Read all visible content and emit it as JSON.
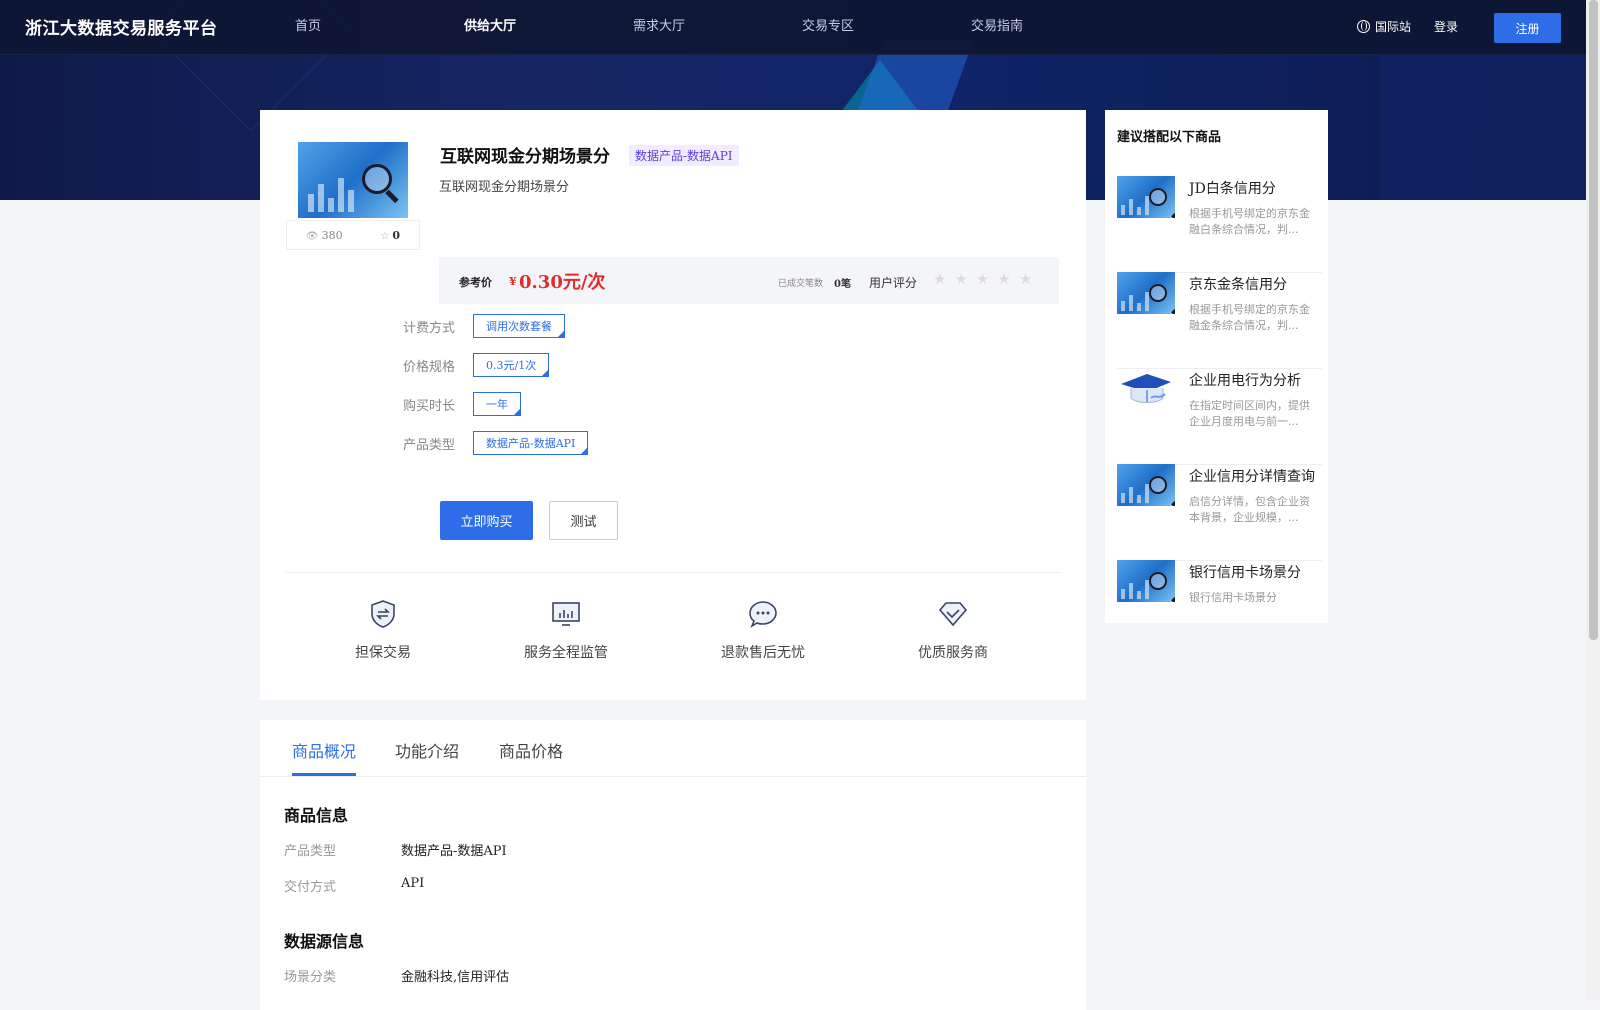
{
  "header": {
    "logo": "浙江大数据交易服务平台",
    "nav": [
      "首页",
      "供给大厅",
      "需求大厅",
      "交易专区",
      "交易指南"
    ],
    "active_nav": "供给大厅",
    "intl": "国际站",
    "login": "登录",
    "register": "注册"
  },
  "product": {
    "title": "互联网现金分期场景分",
    "tag": "数据产品-数据API",
    "desc": "互联网现金分期场景分",
    "views": "380",
    "favorites": "0",
    "price_label": "参考价",
    "price_symbol": "¥",
    "price_value": "0.30元/次",
    "deals_label": "已成交笔数",
    "deals_value": "0笔",
    "rating_label": "用户评分",
    "rating_stars": 0,
    "options": [
      {
        "label": "计费方式",
        "value": "调用次数套餐"
      },
      {
        "label": "价格规格",
        "value": "0.3元/1次"
      },
      {
        "label": "购买时长",
        "value": "一年"
      },
      {
        "label": "产品类型",
        "value": "数据产品-数据API"
      }
    ],
    "buy_label": "立即购买",
    "test_label": "测试"
  },
  "features": [
    {
      "icon": "shield-exchange-icon",
      "label": "担保交易"
    },
    {
      "icon": "monitor-chart-icon",
      "label": "服务全程监管"
    },
    {
      "icon": "chat-bubble-icon",
      "label": "退款售后无忧"
    },
    {
      "icon": "diamond-check-icon",
      "label": "优质服务商"
    }
  ],
  "tabs": [
    "商品概况",
    "功能介绍",
    "商品价格"
  ],
  "active_tab": "商品概况",
  "details": {
    "section1_title": "商品信息",
    "section1": [
      {
        "k": "产品类型",
        "v": "数据产品-数据API"
      },
      {
        "k": "交付方式",
        "v": "API"
      }
    ],
    "section2_title": "数据源信息",
    "section2": [
      {
        "k": "场景分类",
        "v": "金融科技,信用评估"
      }
    ]
  },
  "sidebar": {
    "title": "建议搭配以下商品",
    "items": [
      {
        "title": "JD白条信用分",
        "desc": "根据手机号绑定的京东金融白条综合情况，判...",
        "icon": "data-magnifier-icon"
      },
      {
        "title": "京东金条信用分",
        "desc": "根据手机号绑定的京东金融金条综合情况，判...",
        "icon": "data-magnifier-icon"
      },
      {
        "title": "企业用电行为分析",
        "desc": "在指定时间区间内，提供企业月度用电与前一...",
        "icon": "graduation-chart-icon"
      },
      {
        "title": "企业信用分详情查询",
        "desc": "启信分详情，包含企业资本背景，企业规模，...",
        "icon": "data-magnifier-icon"
      },
      {
        "title": "银行信用卡场景分",
        "desc": "银行信用卡场景分",
        "icon": "data-magnifier-icon"
      }
    ]
  },
  "colors": {
    "accent": "#2f6de8",
    "price": "#e02c2c",
    "tag_bg": "#f1ecff",
    "tag_fg": "#5b3ce0"
  }
}
